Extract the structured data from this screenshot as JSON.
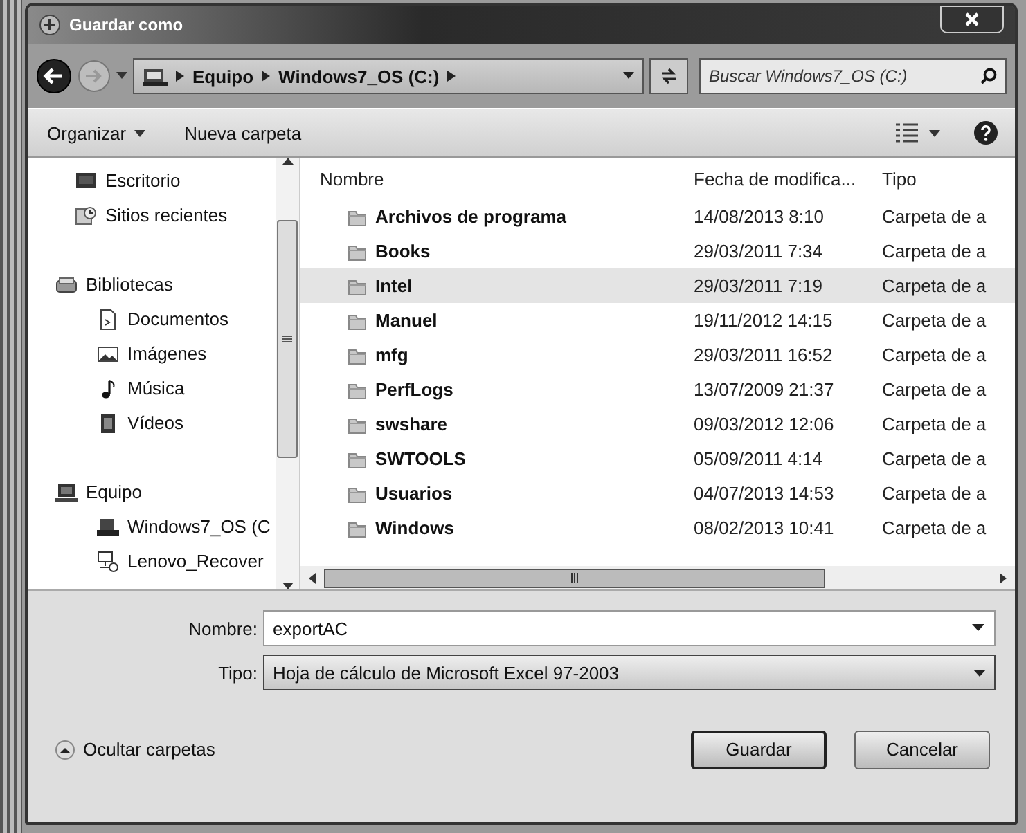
{
  "window": {
    "title": "Guardar como"
  },
  "address": {
    "crumbs": [
      "Equipo",
      "Windows7_OS (C:)"
    ]
  },
  "search": {
    "placeholder": "Buscar Windows7_OS (C:)"
  },
  "toolbar": {
    "buttons": [
      {
        "label": "Organizar",
        "kind": "menu"
      },
      {
        "label": "Nueva carpeta",
        "kind": "plain"
      }
    ]
  },
  "sidebar": {
    "items": [
      {
        "label": "Escritorio",
        "kind": "desktop"
      },
      {
        "label": "Sitios recientes",
        "kind": "recent"
      },
      {
        "label": "Bibliotecas",
        "kind": "library",
        "children": [
          {
            "label": "Documentos",
            "kind": "document"
          },
          {
            "label": "Imágenes",
            "kind": "image"
          },
          {
            "label": "Música",
            "kind": "music"
          },
          {
            "label": "Vídeos",
            "kind": "video"
          }
        ]
      },
      {
        "label": "Equipo",
        "kind": "computer",
        "children": [
          {
            "label": "Windows7_OS (C",
            "kind": "drive"
          },
          {
            "label": "Lenovo_Recover",
            "kind": "netdrive"
          }
        ]
      }
    ]
  },
  "table": {
    "columns": [
      "Nombre",
      "Fecha de modifica...",
      "Tipo"
    ],
    "rows": [
      {
        "name": "Archivos de programa",
        "date": "14/08/2013 8:10",
        "type": "Carpeta de a",
        "selected": false
      },
      {
        "name": "Books",
        "date": "29/03/2011 7:34",
        "type": "Carpeta de a",
        "selected": false
      },
      {
        "name": "Intel",
        "date": "29/03/2011 7:19",
        "type": "Carpeta de a",
        "selected": true
      },
      {
        "name": "Manuel",
        "date": "19/11/2012 14:15",
        "type": "Carpeta de a",
        "selected": false
      },
      {
        "name": "mfg",
        "date": "29/03/2011 16:52",
        "type": "Carpeta de a",
        "selected": false
      },
      {
        "name": "PerfLogs",
        "date": "13/07/2009 21:37",
        "type": "Carpeta de a",
        "selected": false
      },
      {
        "name": "swshare",
        "date": "09/03/2012 12:06",
        "type": "Carpeta de a",
        "selected": false
      },
      {
        "name": "SWTOOLS",
        "date": "05/09/2011 4:14",
        "type": "Carpeta de a",
        "selected": false
      },
      {
        "name": "Usuarios",
        "date": "04/07/2013 14:53",
        "type": "Carpeta de a",
        "selected": false
      },
      {
        "name": "Windows",
        "date": "08/02/2013 10:41",
        "type": "Carpeta de a",
        "selected": false
      }
    ]
  },
  "form": {
    "fields": [
      {
        "label": "Nombre:",
        "value": "exportAC",
        "kind": "combo"
      },
      {
        "label": "Tipo:",
        "value": "Hoja de cálculo de Microsoft Excel 97-2003",
        "kind": "select"
      }
    ]
  },
  "hide_folders": "Ocultar carpetas",
  "buttons": [
    {
      "label": "Guardar",
      "default": true
    },
    {
      "label": "Cancelar",
      "default": false
    }
  ]
}
